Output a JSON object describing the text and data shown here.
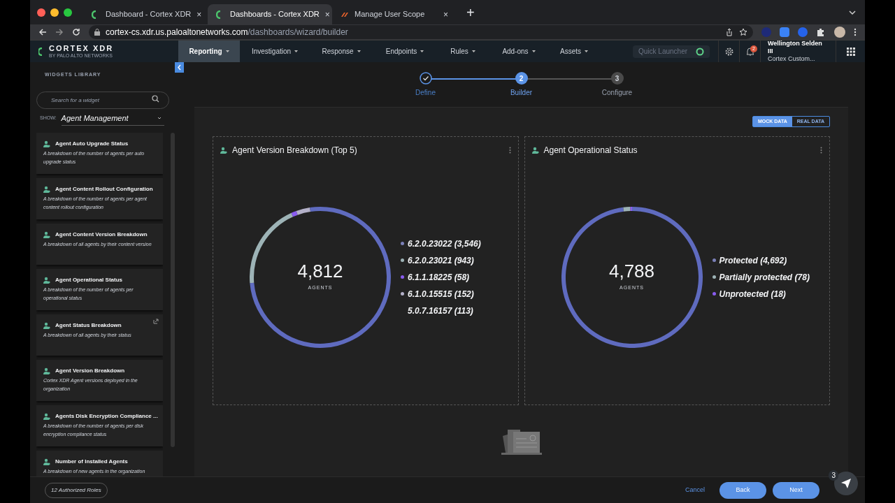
{
  "browser": {
    "tabs": [
      {
        "title": "Dashboard - Cortex XDR",
        "selected": false,
        "kind": "cortex",
        "close": "×"
      },
      {
        "title": "Dashboards - Cortex XDR",
        "selected": true,
        "kind": "cortex",
        "close": "×"
      },
      {
        "title": "Manage User Scope",
        "selected": false,
        "kind": "other",
        "close": "×"
      }
    ],
    "new_tab": "+",
    "url_host": "cortex-cs.xdr.us.paloaltonetworks.com",
    "url_path": "/dashboards/wizard/builder"
  },
  "app": {
    "logo": "CORTEX XDR",
    "logo_sub": "BY PALO ALTO NETWORKS",
    "nav": [
      {
        "label": "Reporting",
        "selected": true
      },
      {
        "label": "Investigation",
        "selected": false
      },
      {
        "label": "Response",
        "selected": false
      },
      {
        "label": "Endpoints",
        "selected": false
      },
      {
        "label": "Rules",
        "selected": false
      },
      {
        "label": "Add-ons",
        "selected": false
      },
      {
        "label": "Assets",
        "selected": false
      }
    ],
    "quick_launcher": {
      "placeholder": "Quick Launcher"
    },
    "notifications": "2",
    "user_name": "Wellington Selden III",
    "user_role": "Cortex Custom..."
  },
  "sidebar": {
    "title": "WIDGETS LIBRARY",
    "search": {
      "placeholder": "Search for a widget"
    },
    "show_label": "SHOW:",
    "show_value": "Agent Management",
    "widgets": [
      {
        "title": "Agent Auto Upgrade Status",
        "description": "A breakdown of the number of agents per auto upgrade status",
        "popout": false
      },
      {
        "title": "Agent Content Rollout Configuration",
        "description": "A breakdown of the number of agents per agent content rollout configuration",
        "popout": false
      },
      {
        "title": "Agent Content Version Breakdown",
        "description": "A breakdown of all agents by their content version",
        "popout": false
      },
      {
        "title": "Agent Operational Status",
        "description": "A breakdown of the number of agents per operational status",
        "popout": false
      },
      {
        "title": "Agent Status Breakdown",
        "description": "A breakdown of all agents by their status",
        "popout": true
      },
      {
        "title": "Agent Version Breakdown",
        "description": "Cortex XDR Agent versions deployed in the organization",
        "popout": false
      },
      {
        "title": "Agents Disk Encryption Compliance ...",
        "description": "A breakdown of the number of agents per disk encryption compliance status",
        "popout": false
      },
      {
        "title": "Number of Installed Agents",
        "description": "A breakdown of new agents in the organization",
        "popout": false
      }
    ],
    "roles": "12 Authorized Roles"
  },
  "steps": [
    {
      "label": "Define",
      "completed": true,
      "selected": false
    },
    {
      "number": "2",
      "label": "Builder",
      "completed": false,
      "selected": true
    },
    {
      "number": "3",
      "label": "Configure",
      "completed": false,
      "selected": false
    }
  ],
  "data_toggle": [
    {
      "label": "MOCK DATA",
      "selected": true
    },
    {
      "label": "REAL DATA",
      "selected": false
    }
  ],
  "widgets": [
    {
      "title": "Agent Version Breakdown (Top 5)",
      "total": "4,812",
      "unit": "AGENTS",
      "legend_dots": [
        {
          "color": "#7b80b8"
        },
        {
          "color": "#9db3b6"
        },
        {
          "color": "#8a5cf0"
        },
        {
          "color": "#b3b0c8"
        }
      ],
      "chart_data": {
        "type": "donut",
        "categories": [
          "6.2.0.23022 (3,546)",
          "6.2.0.23021 (943)",
          "6.1.1.18225 (58)",
          "6.1.0.15515 (152)",
          "5.0.7.16157 (113)"
        ],
        "values": [
          3546,
          943,
          58,
          152,
          113
        ]
      }
    },
    {
      "title": "Agent Operational Status",
      "total": "4,788",
      "unit": "AGENTS",
      "legend_dots": [
        {
          "color": "#7b80b8"
        },
        {
          "color": "#9db3b6"
        },
        {
          "color": "#8a5cf0"
        }
      ],
      "chart_data": {
        "type": "donut",
        "categories": [
          "Protected (4,692)",
          "Partially protected (78)",
          "Unprotected (18)"
        ],
        "values": [
          4692,
          78,
          18
        ]
      }
    }
  ],
  "footer": {
    "cancel": "Cancel",
    "back": "Back",
    "next": "Next",
    "help_count": "3"
  }
}
